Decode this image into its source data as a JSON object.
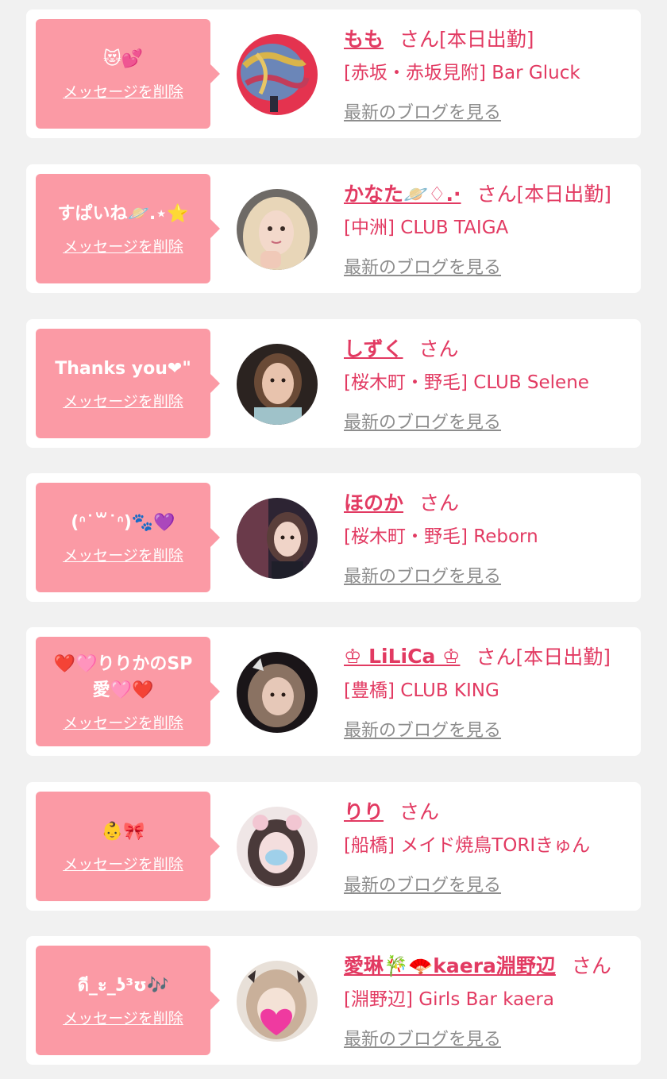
{
  "cards": [
    {
      "message": "😻💕",
      "delete_label": "メッセージを削除",
      "name": "もも",
      "suffix": "さん[本日出勤]",
      "store": "[赤坂・赤坂見附] Bar Gluck",
      "blog_link": "最新のブログを見る"
    },
    {
      "message": "すぱいね🪐.⋆⭐",
      "delete_label": "メッセージを削除",
      "name": "かなた🪐♢.·",
      "suffix": "さん[本日出勤]",
      "store": "[中洲] CLUB TAIGA",
      "blog_link": "最新のブログを見る"
    },
    {
      "message": "Thanks you❤\"",
      "delete_label": "メッセージを削除",
      "name": "しずく",
      "suffix": "さん",
      "store": "[桜木町・野毛] CLUB Selene",
      "blog_link": "最新のブログを見る"
    },
    {
      "message": "(ᐢ˙꒳˙ᐢ)🐾💜",
      "delete_label": "メッセージを削除",
      "name": "ほのか",
      "suffix": "さん",
      "store": "[桜木町・野毛] Reborn",
      "blog_link": "最新のブログを見る"
    },
    {
      "message": "❤️🩷りりかのSP\n愛🩷❤️",
      "delete_label": "メッセージを削除",
      "name": "♔ LiLiCa ♔",
      "suffix": "さん[本日出勤]",
      "store": "[豊橋] CLUB KING",
      "blog_link": "最新のブログを見る"
    },
    {
      "message": "👶🎀",
      "delete_label": "メッセージを削除",
      "name": "りり",
      "suffix": "さん",
      "store": "[船橋] メイド焼鳥TORIきゅん",
      "blog_link": "最新のブログを見る"
    },
    {
      "message": "ดี_ะ_ʖ³ʊ🎶",
      "delete_label": "メッセージを削除",
      "name": "愛琳🎋🪭kaera淵野辺",
      "suffix": "さん",
      "store": "[淵野辺] Girls Bar kaera",
      "blog_link": "最新のブログを見る"
    }
  ]
}
